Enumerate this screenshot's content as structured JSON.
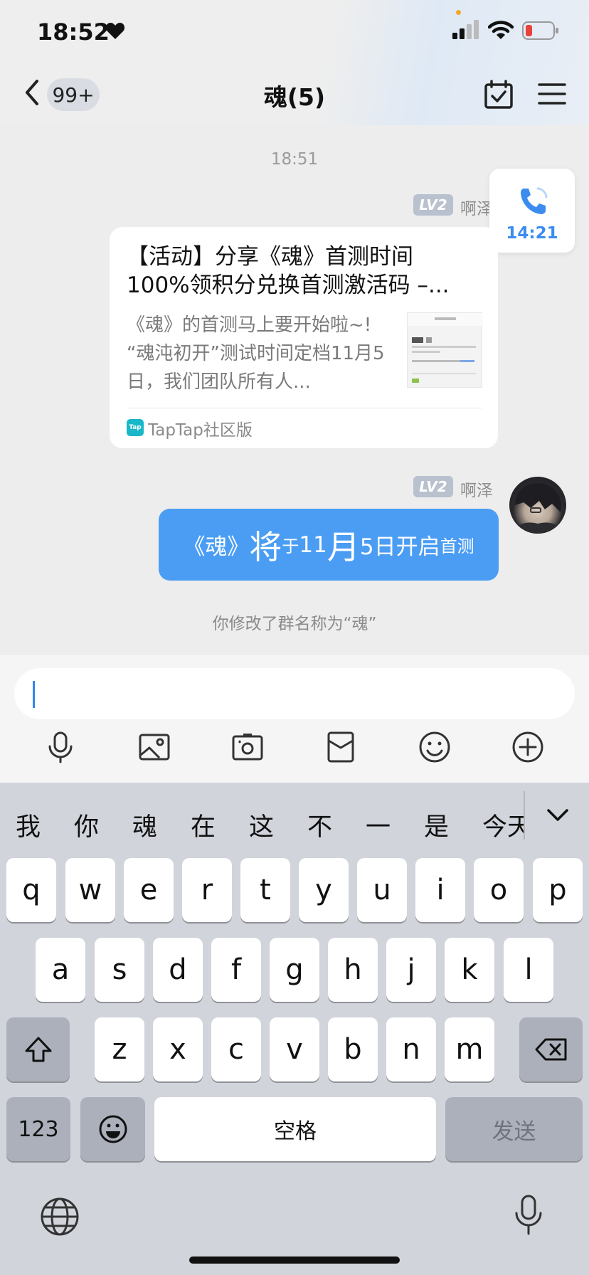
{
  "status_bar": {
    "time": "18:52"
  },
  "header": {
    "unread_count": "99+",
    "title": "魂(5)"
  },
  "chat": {
    "timestamp": "18:51",
    "call_card": {
      "duration": "14:21"
    },
    "messages": [
      {
        "level": "LV2",
        "sender": "啊泽",
        "type": "link_card",
        "title_line1": "【活动】分享《魂》首测时间",
        "title_line2": "100%领积分兑换首测激活码 –...",
        "desc_line1": "《魂》的首测马上要开始啦~!",
        "desc_line2": "“魂沌初开”测试时间定档11月5",
        "desc_line3": "日，我们团队所有人...",
        "source": "TapTap社区版",
        "source_logo": "Tap"
      },
      {
        "level": "LV2",
        "sender": "啊泽",
        "type": "text",
        "parts": [
          "《魂》",
          "将",
          "于",
          "11",
          "月",
          "5日开启",
          "首测"
        ]
      }
    ],
    "system_message": "你修改了群名称为“魂”"
  },
  "toolbar": {
    "icons": [
      "microphone-icon",
      "image-icon",
      "camera-icon",
      "red-packet-icon",
      "emoji-icon",
      "plus-icon"
    ]
  },
  "keyboard": {
    "candidates": [
      "我",
      "你",
      "魂",
      "在",
      "这",
      "不",
      "一",
      "是",
      "今天"
    ],
    "row1": [
      "q",
      "w",
      "e",
      "r",
      "t",
      "y",
      "u",
      "i",
      "o",
      "p"
    ],
    "row2": [
      "a",
      "s",
      "d",
      "f",
      "g",
      "h",
      "j",
      "k",
      "l"
    ],
    "row3": [
      "z",
      "x",
      "c",
      "v",
      "b",
      "n",
      "m"
    ],
    "numbers_label": "123",
    "space_label": "空格",
    "send_label": "发送"
  },
  "colors": {
    "accent": "#4a9df3",
    "call_text": "#3c8cf0",
    "level_badge": "#b9c1cf"
  }
}
